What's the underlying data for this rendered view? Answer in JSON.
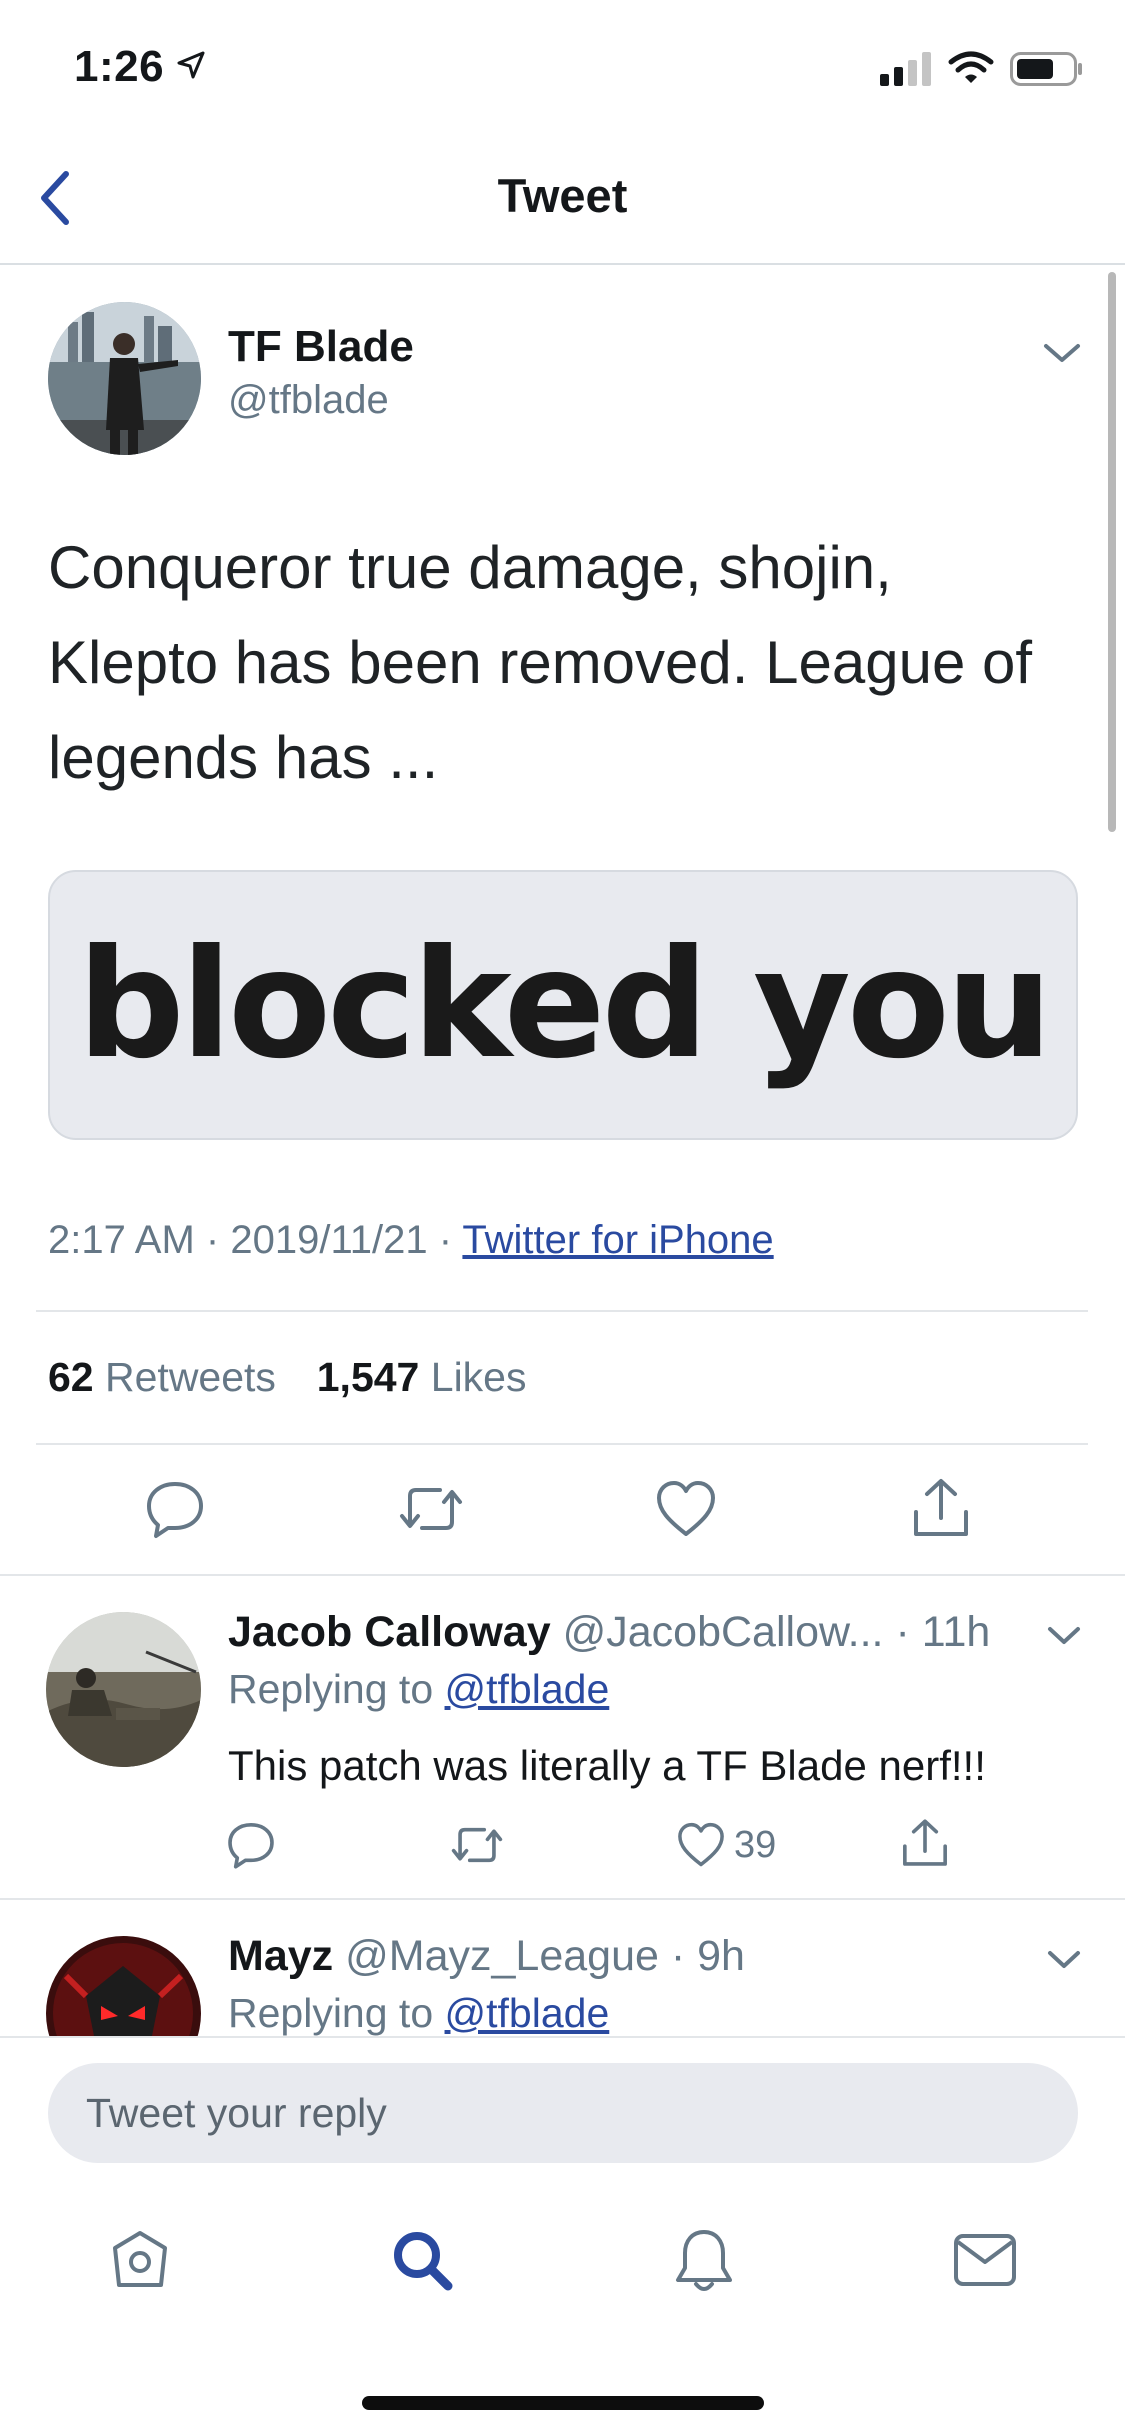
{
  "status_bar": {
    "time": "1:26"
  },
  "nav": {
    "title": "Tweet"
  },
  "tweet": {
    "author_name": "TF Blade",
    "author_handle": "@tfblade",
    "text_lines": [
      "Conqueror true damage, shojin,",
      "Klepto has been removed. League of",
      "legends has ..."
    ],
    "media_text": "blocked you",
    "time": "2:17 AM",
    "date": "2019/11/21",
    "separator": "·",
    "source": "Twitter for iPhone",
    "retweets_count": "62",
    "retweets_label": "Retweets",
    "likes_count": "1,547",
    "likes_label": "Likes"
  },
  "replies": [
    {
      "name": "Jacob Calloway",
      "handle": "@JacobCallow...",
      "time": "· 11h",
      "replying_prefix": "Replying to",
      "replying_handle": "@tfblade",
      "text": "This patch was literally a TF Blade nerf!!!",
      "like_count": "39"
    },
    {
      "name": "Mayz",
      "handle": "@Mayz_League",
      "time": "· 9h",
      "replying_prefix": "Replying to",
      "replying_handle": "@tfblade"
    }
  ],
  "composer": {
    "placeholder": "Tweet your reply"
  },
  "colors": {
    "accent": "#2a4aa0",
    "muted": "#657786",
    "divider": "#e3e6e9",
    "input_bg": "#e8eaef"
  },
  "icons": [
    "back-chevron-icon",
    "location-arrow-icon",
    "signal-icon",
    "wifi-icon",
    "battery-icon",
    "chevron-down-icon",
    "reply-icon",
    "retweet-icon",
    "like-icon",
    "share-icon",
    "home-icon",
    "search-icon",
    "notifications-icon",
    "messages-icon"
  ]
}
